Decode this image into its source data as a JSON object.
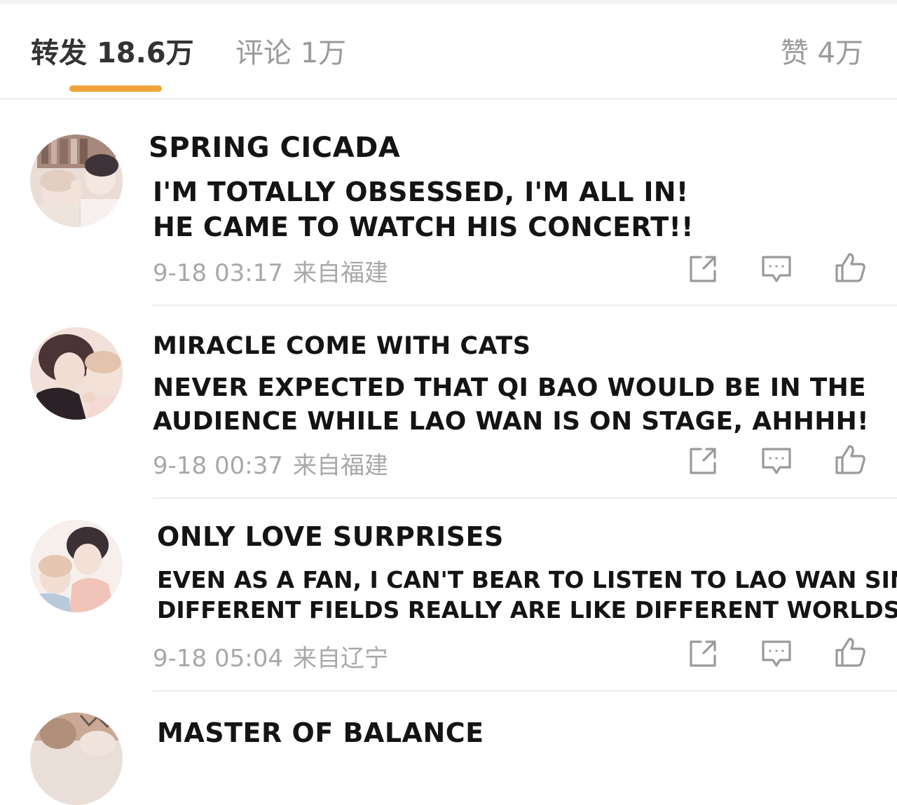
{
  "tabs": {
    "repost": {
      "label": "转发",
      "count": "18.6万"
    },
    "comment": {
      "label": "评论",
      "count": "1万"
    },
    "like": {
      "label": "赞",
      "count": "4万"
    }
  },
  "colors": {
    "accent": "#f0a33a",
    "icon": "#9a9a9a",
    "text": "#141414",
    "meta": "#a8a8a8"
  },
  "comments": [
    {
      "username": "SPRING CICADA",
      "lines": [
        "I'M TOTALLY OBSESSED, I'M ALL IN!",
        "HE CAME TO WATCH HIS CONCERT!!"
      ],
      "time": "9-18 03:17",
      "location": "来自福建"
    },
    {
      "username": "MIRACLE COME WITH CATS",
      "lines": [
        "NEVER EXPECTED THAT QI BAO WOULD BE IN THE",
        "AUDIENCE WHILE LAO WAN IS ON STAGE, AHHHH!"
      ],
      "time": "9-18 00:37",
      "location": "来自福建"
    },
    {
      "username": "ONLY LOVE SURPRISES",
      "lines": [
        "EVEN AS A FAN, I CAN'T BEAR TO LISTEN TO LAO WAN SING,",
        "DIFFERENT FIELDS REALLY ARE LIKE DIFFERENT WORLDS!"
      ],
      "time": "9-18 05:04",
      "location": "来自辽宁"
    },
    {
      "username": "MASTER OF BALANCE"
    }
  ],
  "icons": {
    "share": "share-icon",
    "comment": "comment-icon",
    "like": "thumbs-up-icon"
  }
}
